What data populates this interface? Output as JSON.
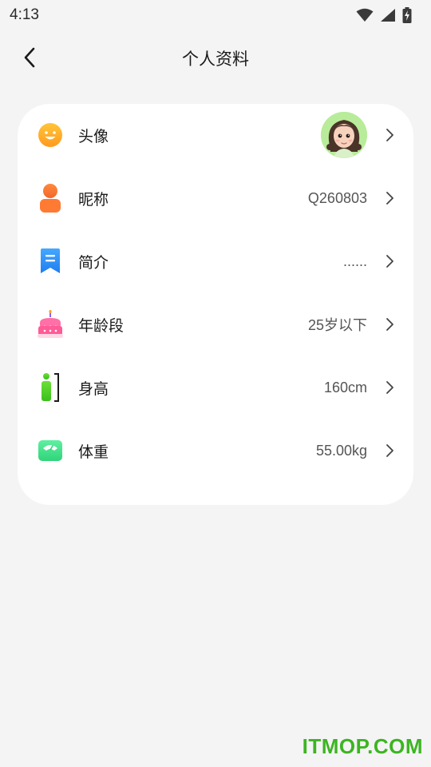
{
  "status_bar": {
    "time": "4:13",
    "icons": [
      "wifi-icon",
      "signal-icon",
      "battery-charging-icon"
    ]
  },
  "header": {
    "title": "个人资料",
    "back_icon": "chevron-left-icon"
  },
  "profile": {
    "rows": [
      {
        "key": "avatar",
        "label": "头像",
        "icon": "smiley-face-icon",
        "value": "",
        "chevron": ">"
      },
      {
        "key": "nickname",
        "label": "昵称",
        "icon": "person-icon",
        "value": "Q260803",
        "chevron": ">"
      },
      {
        "key": "bio",
        "label": "简介",
        "icon": "bookmark-note-icon",
        "value": "......",
        "chevron": ">"
      },
      {
        "key": "age",
        "label": "年龄段",
        "icon": "birthday-cake-icon",
        "value": "25岁以下",
        "chevron": ">"
      },
      {
        "key": "height",
        "label": "身高",
        "icon": "height-measure-icon",
        "value": "160cm",
        "chevron": ">"
      },
      {
        "key": "weight",
        "label": "体重",
        "icon": "weighing-scale-icon",
        "value": "55.00kg",
        "chevron": ">"
      }
    ]
  },
  "colors": {
    "background": "#f4f4f5",
    "card": "#ffffff",
    "avatar_bg": "#b8ec9a",
    "watermark": "#3cb521"
  },
  "watermark": "ITMOP.COM"
}
